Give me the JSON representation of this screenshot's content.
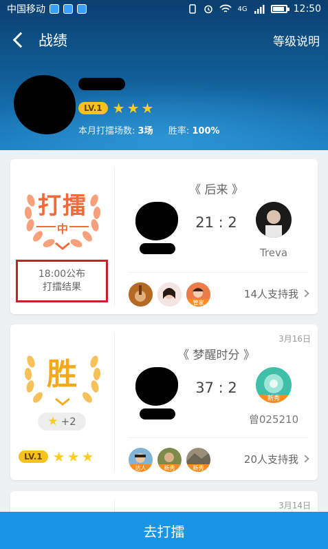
{
  "status_bar": {
    "carrier": "中国移动",
    "network": "4G",
    "time": "12:50"
  },
  "nav": {
    "title": "战绩",
    "right_label": "等级说明"
  },
  "profile": {
    "level": "LV.1",
    "stars": 3,
    "stats_label1": "本月打擂场数:",
    "stats_value1": "3场",
    "stats_label2": "胜率:",
    "stats_value2": "100%"
  },
  "cards": [
    {
      "status_big": "打擂",
      "status_mid": "中",
      "publish_line1": "18:00公布",
      "publish_line2": "打擂结果",
      "song": "《 后来 》",
      "score": "21 : 2",
      "opponent": "Treva",
      "support_tags": [
        "",
        "",
        "管家"
      ],
      "support_text": "14人支持我"
    },
    {
      "date": "3月16日",
      "status_big": "胜",
      "bonus": "+2",
      "level": "LV.1",
      "stars": 3,
      "song": "《 梦醒时分 》",
      "score": "37 : 2",
      "opponent": "曾025210",
      "opponent_tag": "新秀",
      "support_tags": [
        "达人",
        "新秀",
        "新秀"
      ],
      "support_text": "20人支持我"
    },
    {
      "date": "3月14日"
    }
  ],
  "bottom_button": "去打擂",
  "colors": {
    "accent": "#1895e4",
    "orange": "#f06a3b",
    "gold": "#f4a91c",
    "highlight_box": "#c8202a"
  }
}
